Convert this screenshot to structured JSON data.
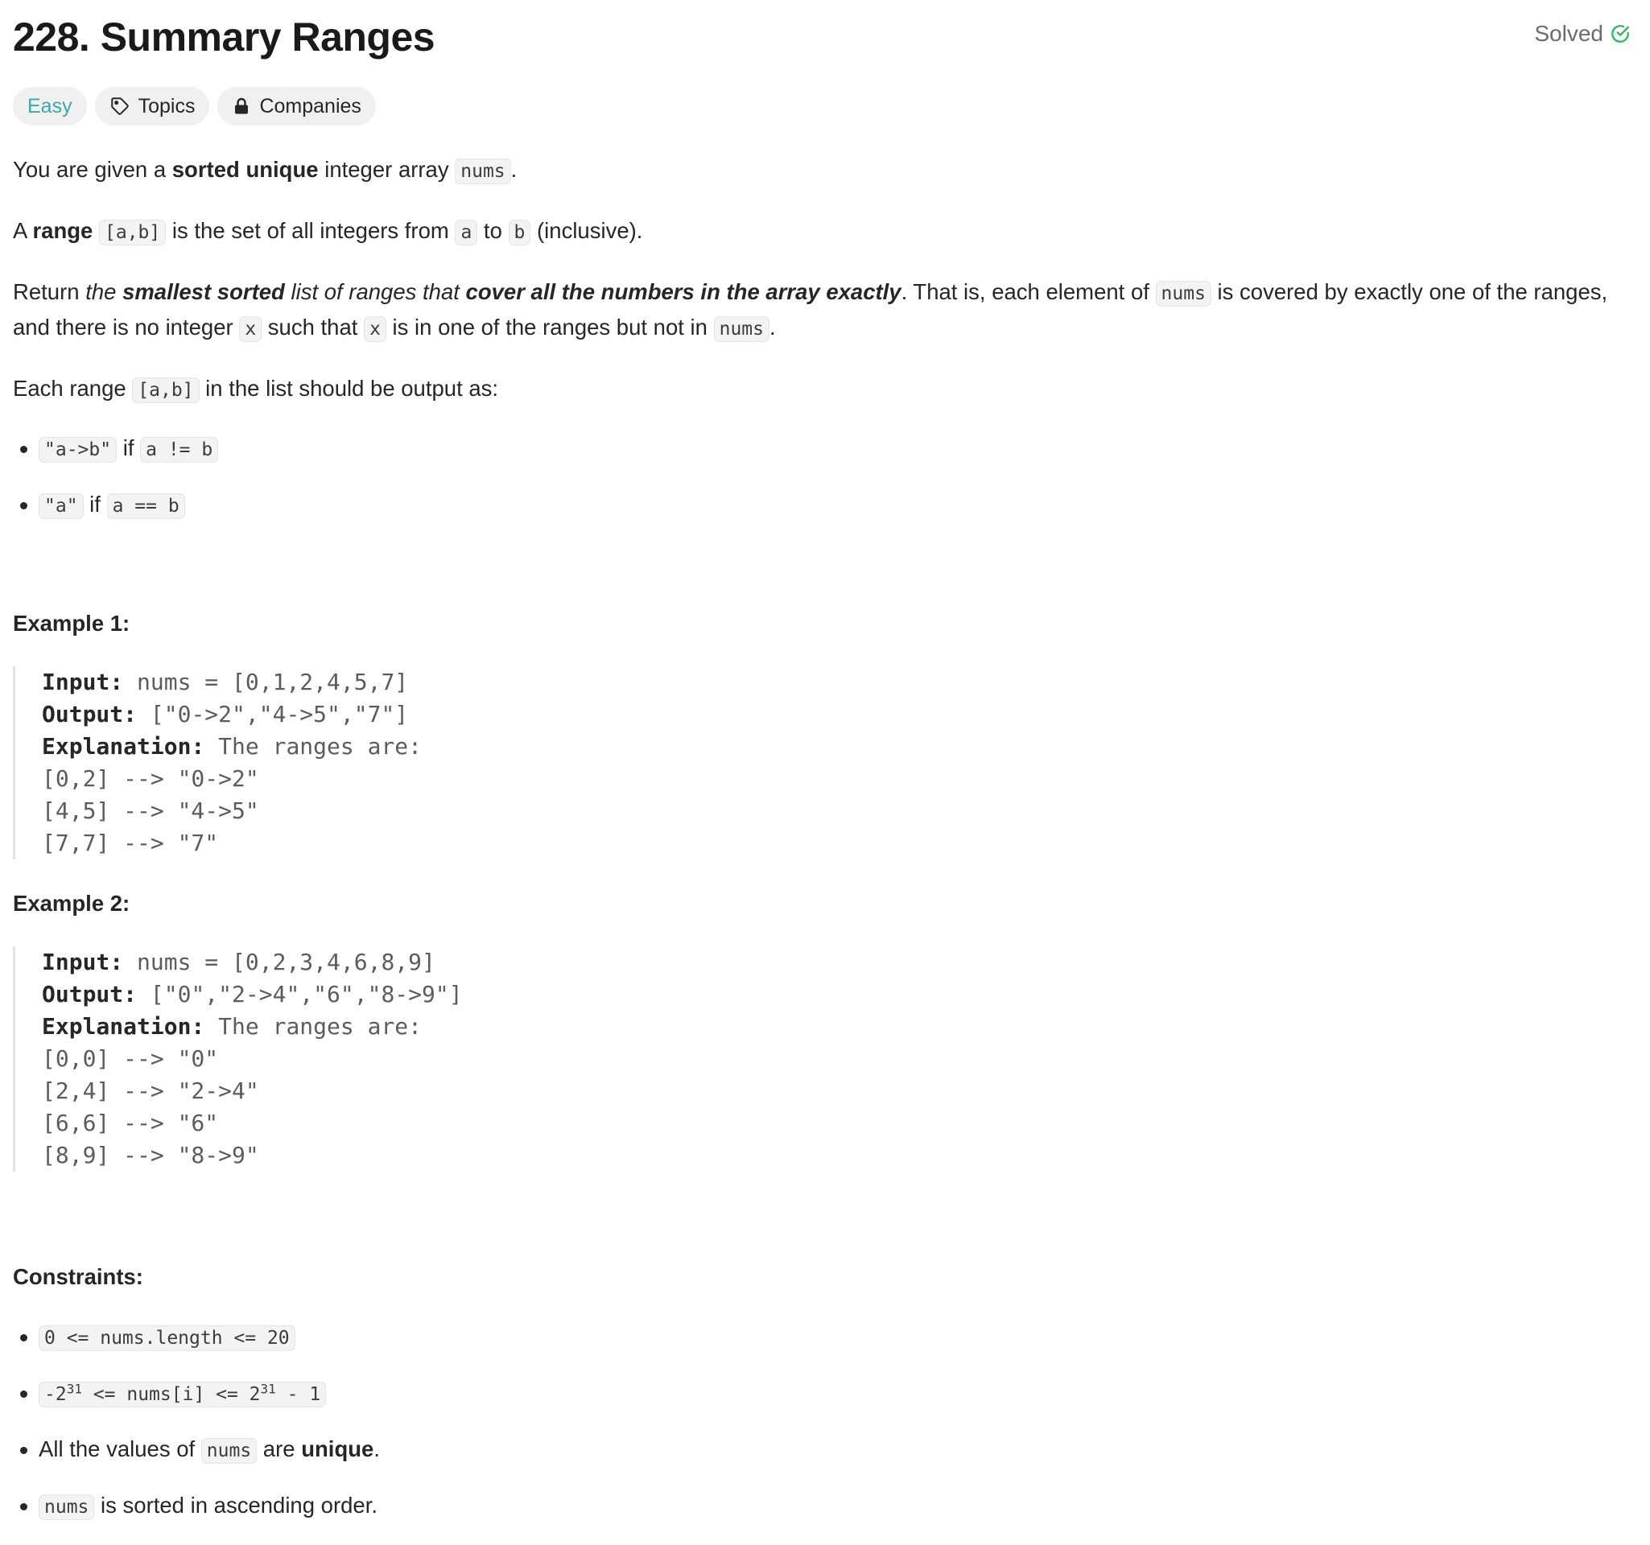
{
  "problem": {
    "title": "228. Summary Ranges",
    "status": "Solved",
    "tags": {
      "difficulty": "Easy",
      "topics": "Topics",
      "companies": "Companies"
    }
  },
  "description": {
    "p1": {
      "t1": "You are given a ",
      "b1": "sorted unique",
      "t2": " integer array ",
      "c1": "nums",
      "t3": "."
    },
    "p2": {
      "t1": "A ",
      "b1": "range",
      "t2": " ",
      "c1": "[a,b]",
      "t3": " is the set of all integers from ",
      "c2": "a",
      "t4": " to ",
      "c3": "b",
      "t5": " (inclusive)."
    },
    "p3": {
      "t1": "Return ",
      "i1": "the ",
      "bi1": "smallest sorted",
      "i2": " list of ranges that ",
      "bi2": "cover all the numbers in the array exactly",
      "t2": ". That is, each element of ",
      "c1": "nums",
      "t3": " is covered by exactly one of the ranges, and there is no integer ",
      "c2": "x",
      "t4": " such that ",
      "c3": "x",
      "t5": " is in one of the ranges but not in ",
      "c4": "nums",
      "t6": "."
    },
    "p4": {
      "t1": "Each range ",
      "c1": "[a,b]",
      "t2": " in the list should be output as:"
    },
    "rules": [
      {
        "c1": "\"a->b\"",
        "t1": " if ",
        "c2": "a != b"
      },
      {
        "c1": "\"a\"",
        "t1": " if ",
        "c2": "a == b"
      }
    ]
  },
  "examples": [
    {
      "heading": "Example 1:",
      "input_label": "Input:",
      "input_value": " nums = [0,1,2,4,5,7]",
      "output_label": "Output:",
      "output_value": " [\"0->2\",\"4->5\",\"7\"]",
      "explanation_label": "Explanation:",
      "explanation_value": " The ranges are:",
      "lines": [
        "[0,2] --> \"0->2\"",
        "[4,5] --> \"4->5\"",
        "[7,7] --> \"7\""
      ]
    },
    {
      "heading": "Example 2:",
      "input_label": "Input:",
      "input_value": " nums = [0,2,3,4,6,8,9]",
      "output_label": "Output:",
      "output_value": " [\"0\",\"2->4\",\"6\",\"8->9\"]",
      "explanation_label": "Explanation:",
      "explanation_value": " The ranges are:",
      "lines": [
        "[0,0] --> \"0\"",
        "[2,4] --> \"2->4\"",
        "[6,6] --> \"6\"",
        "[8,9] --> \"8->9\""
      ]
    }
  ],
  "constraints": {
    "heading": "Constraints:",
    "c1": "0 <= nums.length <= 20",
    "c2": {
      "pre": "-2",
      "exp1": "31",
      "mid": " <= nums[i] <= 2",
      "exp2": "31",
      "post": " - 1"
    },
    "c3": {
      "t1": "All the values of ",
      "c1": "nums",
      "t2": " are ",
      "b1": "unique",
      "t3": "."
    },
    "c4": {
      "c1": "nums",
      "t1": " is sorted in ascending order."
    }
  },
  "colors": {
    "easy": "#3ea6a8",
    "solved_check": "#2cbb5d",
    "text": "#262626",
    "muted": "#6b6b6b"
  },
  "icons": {
    "solved": "check-circle-icon",
    "topics": "tag-icon",
    "companies": "lock-icon"
  }
}
